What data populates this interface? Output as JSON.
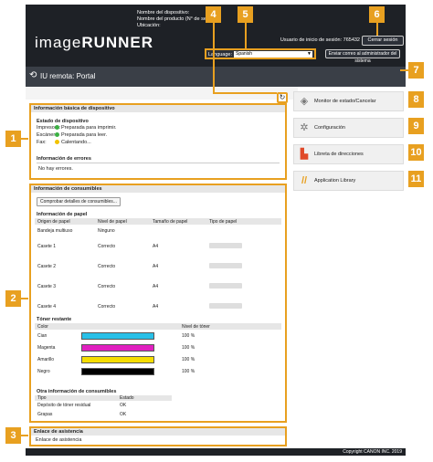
{
  "header": {
    "brand_light": "image",
    "brand_bold": "RUNNER",
    "device_name_label": "Nombre del dispositivo:",
    "product_name_label": "Nombre del producto (N° de serie):",
    "location_label": "Ubicación:",
    "user_label": "Usuario de inicio de sesión:",
    "user_value": "765432",
    "logout_label": "Cerrar sesión",
    "language_label": "Language:",
    "language_value": "Spanish",
    "mail_admin_label": "Enviar correo al administrador del sistema"
  },
  "portal": {
    "title": "IU remota: Portal"
  },
  "basic_info": {
    "title": "Información básica de dispositivo",
    "status_heading": "Estado de dispositivo",
    "statuses": [
      {
        "device": "Impresora:",
        "text": "Preparada para imprimir.",
        "color": "#3cb043"
      },
      {
        "device": "Escáner:",
        "text": "Preparada para leer.",
        "color": "#3cb043"
      },
      {
        "device": "Fax:",
        "text": "Calentando...",
        "color": "#f2c200"
      }
    ],
    "errors_heading": "Información de errores",
    "errors_text": "No hay errores."
  },
  "consumables": {
    "title": "Información de consumibles",
    "check_button": "Comprobar detalles de consumibles...",
    "paper_heading": "Información de papel",
    "paper_columns": [
      "Origen de papel",
      "Nivel de papel",
      "Tamaño de papel",
      "Tipo de papel"
    ],
    "paper_rows": [
      {
        "source": "Bandeja multiuso",
        "level": "Ninguno",
        "size": ""
      },
      {
        "source": "Casete 1",
        "level": "Correcto",
        "size": "A4"
      },
      {
        "source": "Casete 2",
        "level": "Correcto",
        "size": "A4"
      },
      {
        "source": "Casete 3",
        "level": "Correcto",
        "size": "A4"
      },
      {
        "source": "Casete 4",
        "level": "Correcto",
        "size": "A4"
      }
    ],
    "toner_heading": "Tóner restante",
    "toner_columns": [
      "Color",
      "",
      "Nivel de tóner"
    ],
    "toner_rows": [
      {
        "name": "Cian",
        "level": "100 %",
        "color": "#29c0e8"
      },
      {
        "name": "Magenta",
        "level": "100 %",
        "color": "#e020c0"
      },
      {
        "name": "Amarillo",
        "level": "100 %",
        "color": "#f5dd00"
      },
      {
        "name": "Negro",
        "level": "100 %",
        "color": "#000000"
      }
    ],
    "other_heading": "Otra información de consumibles",
    "other_columns": [
      "Tipo",
      "Estado"
    ],
    "other_rows": [
      {
        "type": "Depósito de tóner residual",
        "state": "OK"
      },
      {
        "type": "Grapas",
        "state": "OK"
      }
    ]
  },
  "support": {
    "title": "Enlace de asistencia",
    "link": "Enlace de asistencia"
  },
  "side_menu": [
    {
      "label": "Monitor de estado/Cancelar",
      "icon": "status-monitor-icon",
      "glyph": "◈"
    },
    {
      "label": "Configuración",
      "icon": "settings-icon",
      "glyph": "✲"
    },
    {
      "label": "Libreta de direcciones",
      "icon": "address-book-icon",
      "glyph": "▙"
    },
    {
      "label": "Application Library",
      "icon": "application-library-icon",
      "glyph": "//"
    }
  ],
  "callouts": [
    "1",
    "2",
    "3",
    "4",
    "5",
    "6",
    "7",
    "8",
    "9",
    "10",
    "11"
  ],
  "footer": {
    "copyright": "Copyright CANON INC. 2019"
  },
  "accent_color": "#e8a020"
}
